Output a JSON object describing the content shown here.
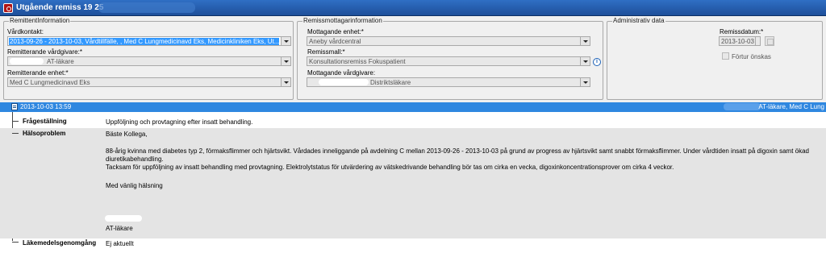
{
  "window": {
    "title": "Utgående remiss 19 25"
  },
  "remittent": {
    "group_label": "RemittentInformation",
    "vardkontakt_label": "Vårdkontakt:",
    "vardkontakt_value": "2013-09-26 - 2013-10-03, Vårdtillfälle, , Med C Lungmedicinavd Eks, Medicinkliniken Eks, Ut...",
    "remitterande_vardgivare_label": "Remitterande vårdgivare:*",
    "remitterande_vardgivare_value": "AT-läkare",
    "remitterande_enhet_label": "Remitterande enhet:*",
    "remitterande_enhet_value": "Med C Lungmedicinavd Eks"
  },
  "mottagare": {
    "group_label": "Remissmottagarinformation",
    "mottagande_enhet_label": "Mottagande enhet:*",
    "mottagande_enhet_value": "Aneby vårdcentral",
    "remissmall_label": "Remissmall:*",
    "remissmall_value": "Konsultationsremiss Fokuspatient",
    "info_icon": "info-icon",
    "mottagande_vardgivare_label": "Mottagande vårdgivare:",
    "mottagande_vardgivare_value": "Distriktsläkare"
  },
  "admin": {
    "group_label": "Administrativ data",
    "remissdatum_label": "Remissdatum:*",
    "remissdatum_value": "2013-10-03",
    "fortur_label": "Förtur önskas"
  },
  "entry": {
    "timestamp": "2013-10-03  13:59",
    "author": "AT-läkare, Med C Lung"
  },
  "rows": {
    "fragestallning_label": "Frågeställning",
    "fragestallning_value": "Uppföljning och provtagning efter insatt behandling.",
    "halsoproblem_label": "Hälsoproblem",
    "halsoproblem_greeting": "Bäste Kollega,",
    "halsoproblem_p1": "88-årig kvinna med diabetes typ 2, förmaksflimmer och hjärtsvikt. Vårdades inneliggande på avdelning C mellan 2013-09-26 - 2013-10-03 på grund av progress av hjärtsvikt samt snabbt förmaksflimmer. Under vårdtiden insatt på digoxin samt ökad diuretikabehandling.",
    "halsoproblem_p2": "Tacksam för uppföljning av insatt behandling med provtagning. Elektrolytstatus för utvärdering av vätskedrivande behandling bör tas om cirka en vecka, digoxinkoncentrationsprover om cirka 4 veckor.",
    "halsoproblem_closing": "Med vänlig hälsning",
    "halsoproblem_signature": "AT-läkare",
    "lakemedel_label": "Läkemedelsgenomgång",
    "lakemedel_value": "Ej aktuellt"
  }
}
